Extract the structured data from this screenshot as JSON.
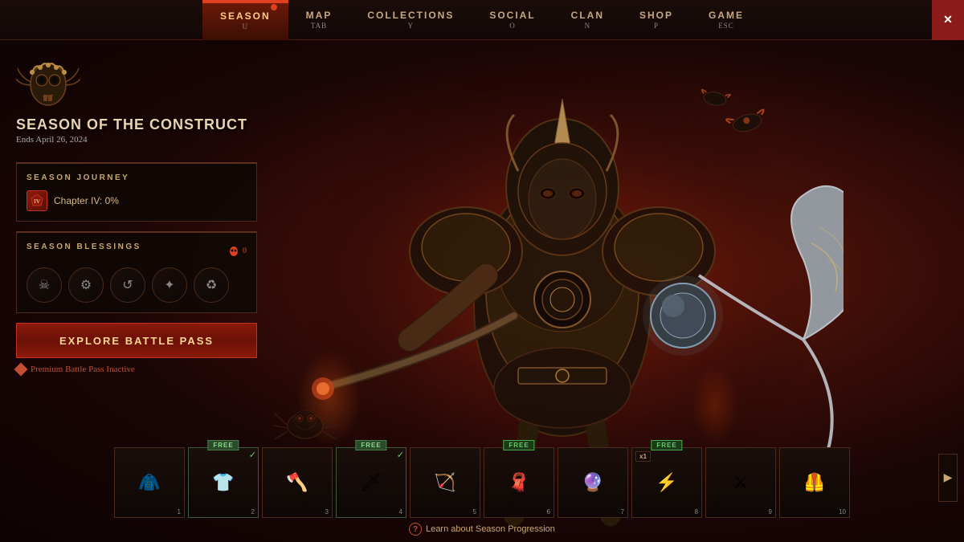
{
  "nav": {
    "items": [
      {
        "id": "season",
        "label": "SEASON",
        "key": "U",
        "active": true
      },
      {
        "id": "map",
        "label": "MAP",
        "key": "TAB",
        "active": false
      },
      {
        "id": "collections",
        "label": "COLLECTIONS",
        "key": "Y",
        "active": false
      },
      {
        "id": "social",
        "label": "SOCIAL",
        "key": "O",
        "active": false
      },
      {
        "id": "clan",
        "label": "CLAN",
        "key": "N",
        "active": false
      },
      {
        "id": "shop",
        "label": "SHOP",
        "key": "P",
        "active": false
      },
      {
        "id": "game",
        "label": "GAME",
        "key": "ESC",
        "active": false
      }
    ],
    "close_label": "✕"
  },
  "season": {
    "title": "SEASON OF THE CONSTRUCT",
    "subtitle": "Ends April 26, 2024",
    "journey": {
      "panel_title": "SEASON JOURNEY",
      "chapter_label": "Chapter IV: 0%"
    },
    "blessings": {
      "panel_title": "SEASON BLESSINGS",
      "count": "0",
      "icons": [
        "☠",
        "⚙",
        "↩",
        "✦",
        "♲"
      ]
    },
    "battle_pass": {
      "button_label": "EXPLORE BATTLE PASS",
      "inactive_label": "Premium Battle Pass Inactive"
    }
  },
  "rewards": [
    {
      "num": "1",
      "type": "armor",
      "free": false,
      "claimed": false,
      "symbol": "🧥"
    },
    {
      "num": "2",
      "type": "chest",
      "free": true,
      "claimed": true,
      "symbol": "👕",
      "badge": "FREE"
    },
    {
      "num": "3",
      "type": "axe",
      "free": false,
      "claimed": false,
      "symbol": "🪓"
    },
    {
      "num": "4",
      "type": "dagger",
      "free": true,
      "claimed": true,
      "symbol": "🗡",
      "badge": "FREE"
    },
    {
      "num": "5",
      "type": "bow",
      "free": false,
      "claimed": false,
      "symbol": "🏹"
    },
    {
      "num": "6",
      "type": "hood",
      "free": true,
      "claimed": false,
      "symbol": "🧣",
      "badge": "FREE"
    },
    {
      "num": "7",
      "type": "orb",
      "free": false,
      "claimed": false,
      "symbol": "🔮"
    },
    {
      "num": "8",
      "type": "rune",
      "free": true,
      "claimed": false,
      "symbol": "⚡",
      "badge": "FREE",
      "x1": true
    },
    {
      "num": "9",
      "type": "sickle",
      "free": false,
      "claimed": false,
      "symbol": "⚔"
    },
    {
      "num": "10",
      "type": "cloak",
      "free": false,
      "claimed": false,
      "symbol": "🦺"
    }
  ],
  "learn_link": "Learn about Season Progression",
  "scroll_right": "▶"
}
